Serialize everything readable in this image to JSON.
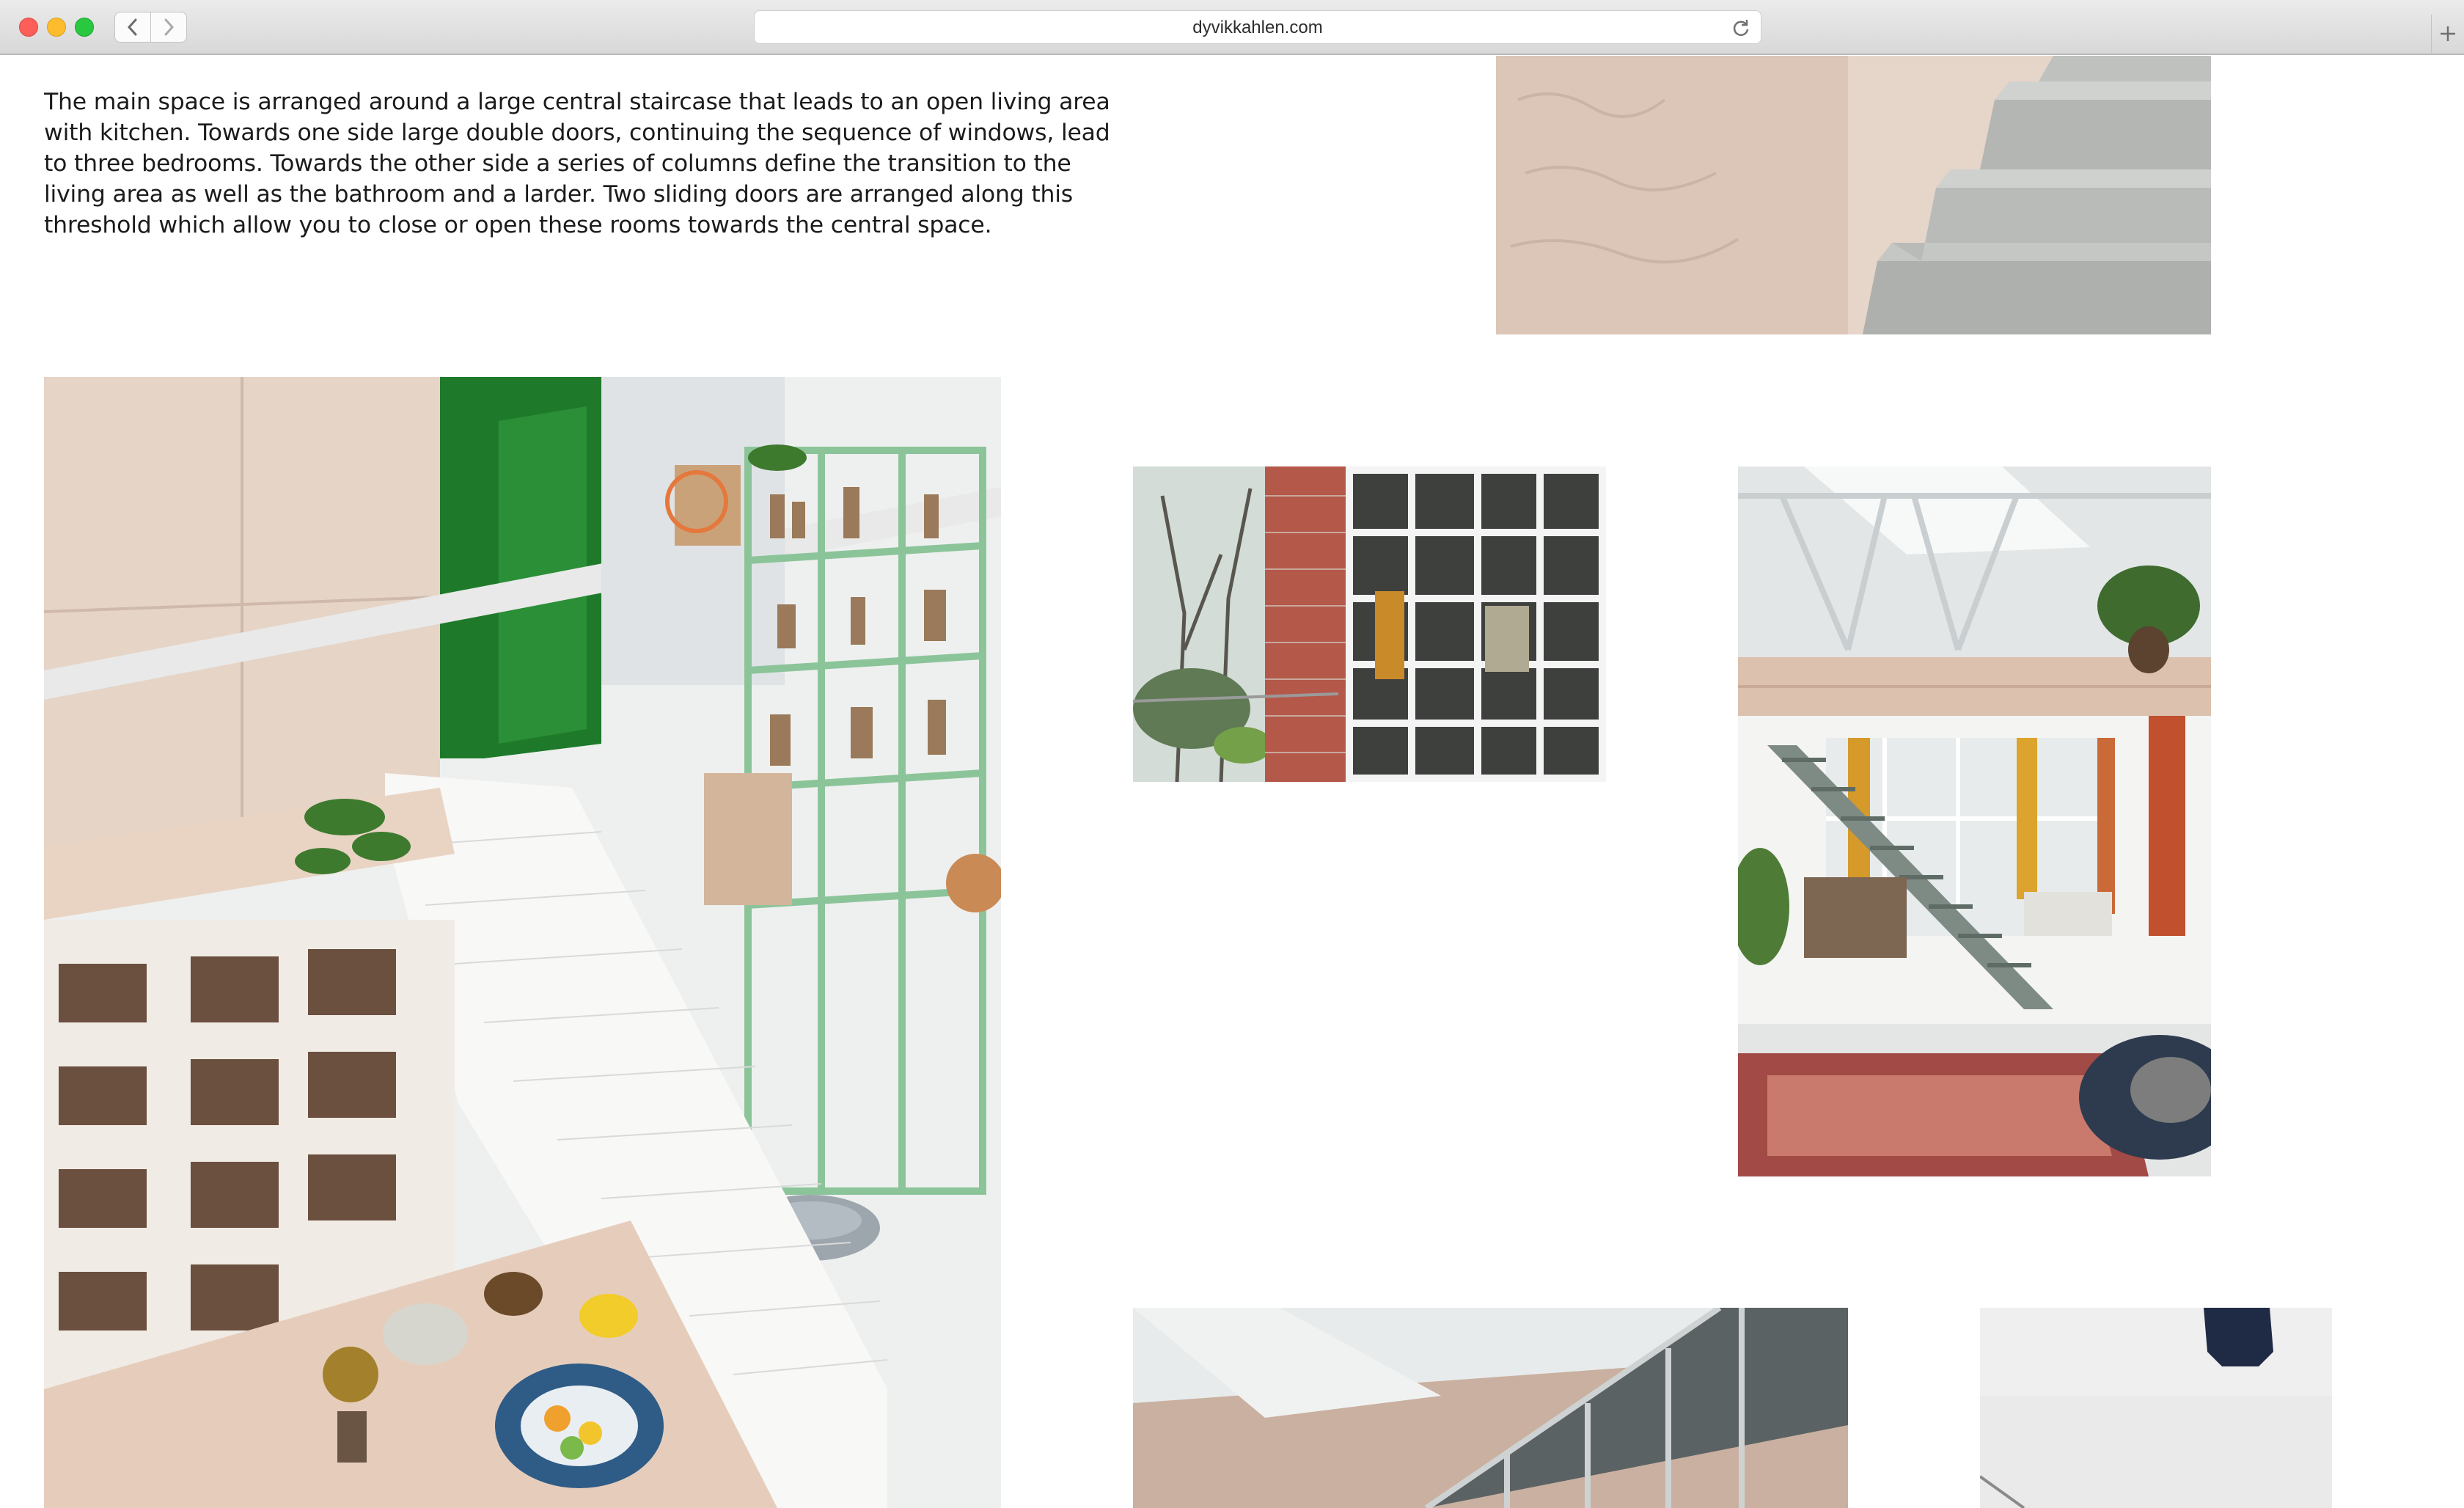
{
  "browser": {
    "url": "dyvikkahlen.com"
  },
  "article": {
    "paragraph": "The main space is arranged around a large central staircase that leads to an open living area with kitchen. Towards one side large double doors, continuing the sequence of windows, lead to three bedrooms. Towards the other side a series of columns define the transition to the living area as well as the bathroom and a larder. Two sliding doors are arranged along this threshold which allow you to close or open these rooms towards the central space."
  },
  "icons": {
    "back": "chevron-left-icon",
    "forward": "chevron-right-icon",
    "reload": "reload-icon",
    "new_tab": "plus-icon"
  },
  "colors": {
    "chrome": "#e0e0e0",
    "text": "#1b1b1b",
    "plywood": "#e7d6c9",
    "shelf_green": "#8cc49a",
    "door_green": "#1e7a2a"
  }
}
